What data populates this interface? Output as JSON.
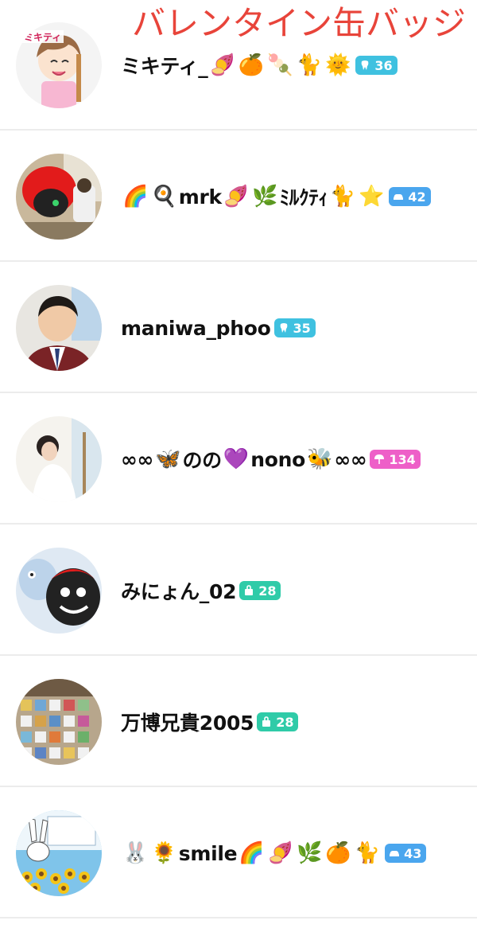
{
  "overlay_title": "バレンタイン缶バッジ",
  "users": [
    {
      "avatar_name": "avatar-mikity-illustration",
      "segments": [
        {
          "t": "text",
          "v": "ミキティ_"
        },
        {
          "t": "emoji",
          "v": "🍠",
          "name": "sweet-potato-emoji"
        },
        {
          "t": "emoji",
          "v": "🍊",
          "name": "tangerine-emoji"
        },
        {
          "t": "emoji",
          "v": "🍡",
          "name": "dango-emoji"
        },
        {
          "t": "emoji",
          "v": "🐈",
          "name": "cat-emoji"
        },
        {
          "t": "emoji",
          "v": "🌞",
          "name": "sun-face-emoji"
        }
      ],
      "badge": {
        "icon": "tooth-icon",
        "value": "36",
        "color": "#3fc1e0"
      }
    },
    {
      "avatar_name": "avatar-red-mascot-photo",
      "segments": [
        {
          "t": "emoji",
          "v": "🌈",
          "name": "rainbow-emoji"
        },
        {
          "t": "emoji",
          "v": "🍳",
          "name": "frying-pan-egg-emoji"
        },
        {
          "t": "text",
          "v": "mrk"
        },
        {
          "t": "emoji",
          "v": "🍠",
          "name": "sweet-potato-emoji"
        },
        {
          "t": "emoji",
          "v": "🌿",
          "name": "herb-emoji"
        },
        {
          "t": "text",
          "v": "ﾐﾙｸﾃｨ"
        },
        {
          "t": "emoji",
          "v": "🐈",
          "name": "cat-emoji"
        },
        {
          "t": "emoji",
          "v": "⭐",
          "name": "star-emoji"
        }
      ],
      "badge": {
        "icon": "car-icon",
        "value": "42",
        "color": "#4aa6ee"
      }
    },
    {
      "avatar_name": "avatar-man-portrait-photo",
      "segments": [
        {
          "t": "text",
          "v": "maniwa_phoo"
        }
      ],
      "badge": {
        "icon": "tooth-icon",
        "value": "35",
        "color": "#3fc1e0"
      }
    },
    {
      "avatar_name": "avatar-woman-photo",
      "segments": [
        {
          "t": "text",
          "v": "∞∞"
        },
        {
          "t": "emoji",
          "v": "🦋",
          "name": "butterfly-emoji"
        },
        {
          "t": "text",
          "v": "のの"
        },
        {
          "t": "emoji",
          "v": "💜",
          "name": "purple-heart-emoji"
        },
        {
          "t": "text",
          "v": "nono"
        },
        {
          "t": "emoji",
          "v": "🐝",
          "name": "bee-emoji"
        },
        {
          "t": "text",
          "v": "∞∞"
        }
      ],
      "badge": {
        "icon": "umbrella-icon",
        "value": "134",
        "color": "#ee5fc8"
      }
    },
    {
      "avatar_name": "avatar-mascots-photo",
      "segments": [
        {
          "t": "text",
          "v": "みにょん_02"
        }
      ],
      "badge": {
        "icon": "bag-icon",
        "value": "28",
        "color": "#2fcba8"
      }
    },
    {
      "avatar_name": "avatar-collection-photo",
      "segments": [
        {
          "t": "text",
          "v": "万博兄貴2005"
        }
      ],
      "badge": {
        "icon": "bag-icon",
        "value": "28",
        "color": "#2fcba8"
      }
    },
    {
      "avatar_name": "avatar-rabbit-sunflower-illustration",
      "segments": [
        {
          "t": "emoji",
          "v": "🐰",
          "name": "rabbit-emoji"
        },
        {
          "t": "emoji",
          "v": "🌻",
          "name": "sunflower-emoji"
        },
        {
          "t": "text",
          "v": "smile"
        },
        {
          "t": "emoji",
          "v": "🌈",
          "name": "rainbow-emoji"
        },
        {
          "t": "emoji",
          "v": "🍠",
          "name": "sweet-potato-emoji"
        },
        {
          "t": "emoji",
          "v": "🌿",
          "name": "herb-emoji"
        },
        {
          "t": "emoji",
          "v": "🍊",
          "name": "tangerine-emoji"
        },
        {
          "t": "emoji",
          "v": "🐈",
          "name": "cat-emoji"
        }
      ],
      "badge": {
        "icon": "car-icon",
        "value": "43",
        "color": "#4aa6ee"
      }
    }
  ]
}
